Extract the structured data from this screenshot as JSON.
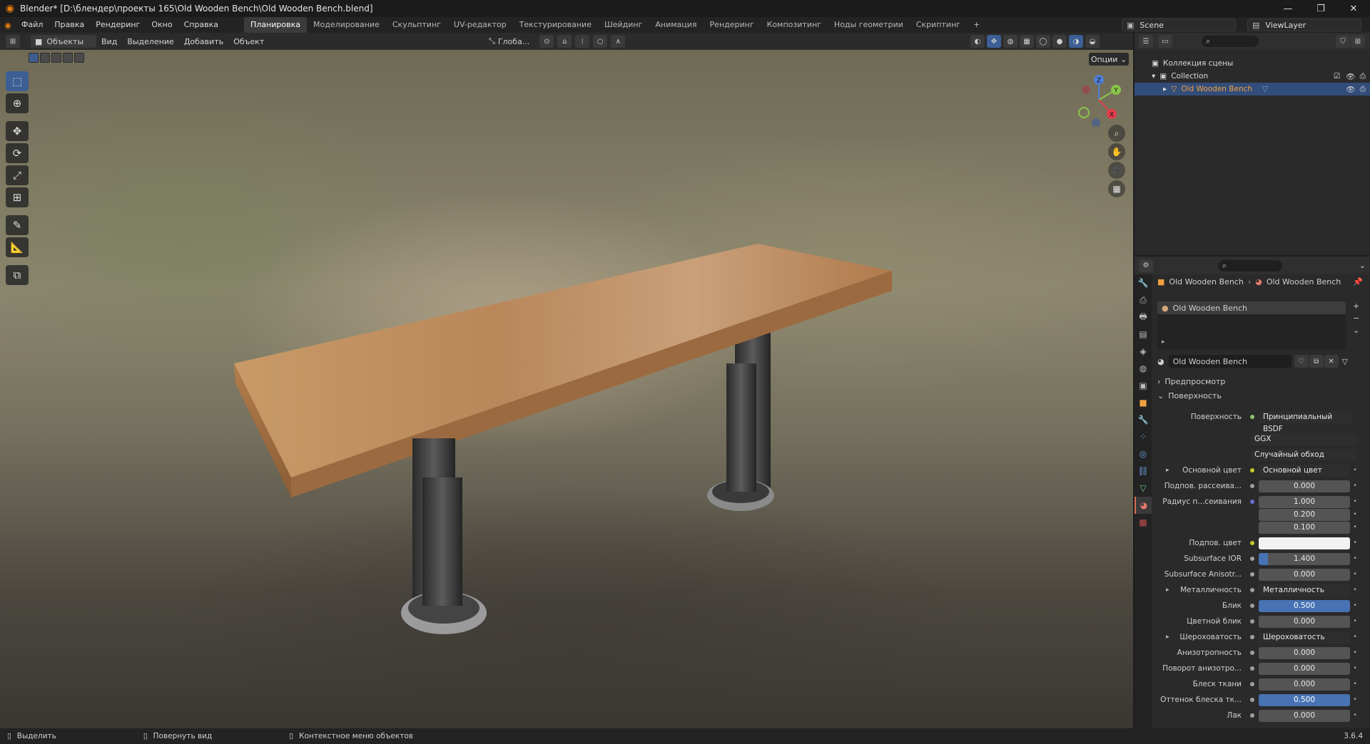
{
  "window": {
    "title": "Blender* [D:\\блендер\\проекты 165\\Old Wooden Bench\\Old Wooden Bench.blend]"
  },
  "menu": [
    "Файл",
    "Правка",
    "Рендеринг",
    "Окно",
    "Справка"
  ],
  "workspaces": [
    "Планировка",
    "Моделирование",
    "Скульптинг",
    "UV-редактор",
    "Текстурирование",
    "Шейдинг",
    "Анимация",
    "Рендеринг",
    "Композитинг",
    "Ноды геометрии",
    "Скриптинг",
    "+"
  ],
  "active_workspace": "Планировка",
  "scene": {
    "scene_name": "Scene",
    "viewlayer_name": "ViewLayer"
  },
  "viewport_header": {
    "mode": "Объекты",
    "menus": [
      "Вид",
      "Выделение",
      "Добавить",
      "Объект"
    ],
    "transform_orientation": "Глоба...",
    "options": "Опции"
  },
  "gizmo": {
    "x": "X",
    "y": "Y",
    "z": "Z"
  },
  "outliner": {
    "rows": [
      "Коллекция сцены",
      "Collection",
      "Old Wooden Bench"
    ]
  },
  "properties": {
    "breadcrumb": [
      "Old Wooden Bench",
      "Old Wooden Bench"
    ],
    "material_slot": "Old Wooden Bench",
    "material_name": "Old Wooden Bench",
    "panels": {
      "preview": "Предпросмотр",
      "surface": "Поверхность"
    },
    "surface": {
      "label": "Поверхность",
      "value": "Принципиальный BSDF",
      "distribution": "GGX",
      "subsurface_method": "Случайный обход",
      "rows": [
        {
          "label": "Основной цвет",
          "value": "Основной цвет"
        },
        {
          "label": "Подпов. рассеива...",
          "value": "0.000"
        },
        {
          "label": "Радиус п...сеивания",
          "value": "1.000"
        },
        {
          "label": "",
          "value": "0.200"
        },
        {
          "label": "",
          "value": "0.100"
        },
        {
          "label": "Подпов. цвет",
          "value": ""
        },
        {
          "label": "Subsurface IOR",
          "value": "1.400"
        },
        {
          "label": "Subsurface Anisotr...",
          "value": "0.000"
        },
        {
          "label": "Металличность",
          "value": "Металличность"
        },
        {
          "label": "Блик",
          "value": "0.500"
        },
        {
          "label": "Цветной блик",
          "value": "0.000"
        },
        {
          "label": "Шероховатость",
          "value": "Шероховатость"
        },
        {
          "label": "Анизотропность",
          "value": "0.000"
        },
        {
          "label": "Поворот анизотро...",
          "value": "0.000"
        },
        {
          "label": "Блеск ткани",
          "value": "0.000"
        },
        {
          "label": "Оттенок блеска тк...",
          "value": "0.500"
        },
        {
          "label": "Лак",
          "value": "0.000"
        }
      ]
    }
  },
  "statusbar": {
    "select": "Выделить",
    "rotate": "Повернуть вид",
    "context": "Контекстное меню объектов",
    "version": "3.6.4"
  },
  "colors": {
    "accent": "#4772b3",
    "selected_row": "#334d7a",
    "material_tab": "#d86d52"
  }
}
